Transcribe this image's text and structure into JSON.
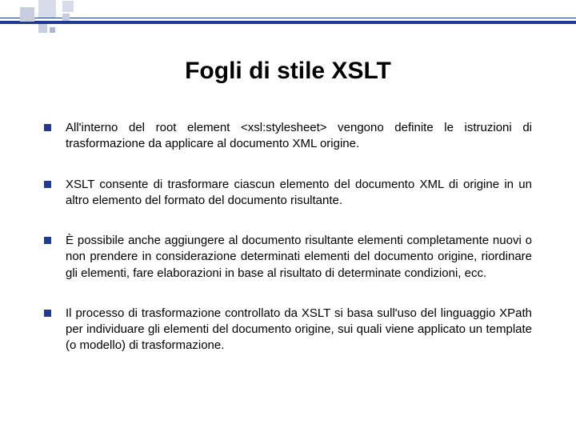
{
  "title": "Fogli di stile XSLT",
  "bullets": [
    "All'interno del root element <xsl:stylesheet> vengono definite le istruzioni di trasformazione da applicare al documento XML origine.",
    "XSLT consente di trasformare ciascun elemento del documento XML di origine in un altro elemento del formato del documento risultante.",
    "È possibile anche aggiungere al documento risultante elementi completamente nuovi o non prendere in considerazione determinati elementi del documento origine, riordinare gli elementi, fare elaborazioni in base al risultato di determinate condizioni, ecc.",
    "Il processo di trasformazione controllato da XSLT si basa sull'uso del linguaggio XPath per individuare gli elementi del documento origine, sui quali viene applicato un template (o modello) di trasformazione."
  ]
}
